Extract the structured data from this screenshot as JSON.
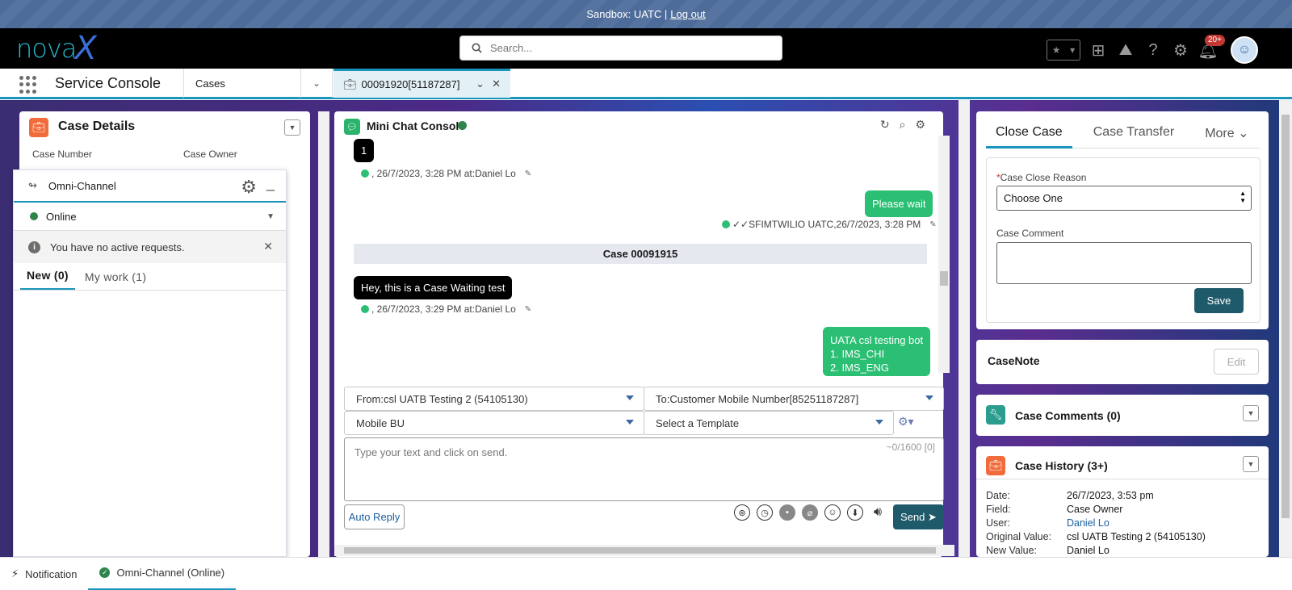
{
  "sandbox": {
    "text": "Sandbox: UATC |",
    "logout": "Log out"
  },
  "topbar": {
    "logo_text": "nova",
    "logo_x": "X",
    "search_placeholder": "Search...",
    "notif_badge": "20+"
  },
  "nav": {
    "app_name": "Service Console",
    "object": "Cases",
    "tab_label": "00091920[51187287]"
  },
  "case_details": {
    "title": "Case Details",
    "case_number_label": "Case Number",
    "case_owner_label": "Case Owner"
  },
  "omni": {
    "title": "Omni-Channel",
    "status": "Online",
    "info": "You have no active requests.",
    "tabs": [
      {
        "label": "New (0)"
      },
      {
        "label": "My work (1)"
      }
    ]
  },
  "chat": {
    "title": "Mini Chat Console",
    "messages": [
      {
        "text": "1",
        "meta": ", 26/7/2023, 3:28 PM at:Daniel Lo"
      },
      {
        "text": "Please wait",
        "meta": "✓✓SFIMTWILIO UATC,26/7/2023, 3:28 PM"
      },
      {
        "separator": "Case 00091915"
      },
      {
        "text": "Hey, this is a Case Waiting test",
        "meta": ", 26/7/2023, 3:29 PM at:Daniel Lo"
      },
      {
        "lines": [
          "UATA csl testing bot",
          "1. IMS_CHI",
          "2. IMS_ENG"
        ]
      }
    ],
    "from": "From:csl UATB Testing 2 (54105130)",
    "to": "To:Customer Mobile Number[85251187287]",
    "bu": "Mobile BU",
    "template": "Select a Template",
    "input_placeholder": "Type your text and click on send.",
    "counter": "~0/1600 [0]",
    "auto_reply": "Auto Reply",
    "send": "Send"
  },
  "close_case": {
    "tabs": [
      "Close Case",
      "Case Transfer",
      "More"
    ],
    "reason_label": "Case Close Reason",
    "reason_value": "Choose One",
    "comment_label": "Case Comment",
    "save": "Save"
  },
  "casenote": {
    "title": "CaseNote",
    "edit": "Edit"
  },
  "case_comments": {
    "title": "Case Comments (0)"
  },
  "case_history": {
    "title": "Case History (3+)",
    "rows": [
      {
        "k": "Date:",
        "v": "26/7/2023, 3:53 pm"
      },
      {
        "k": "Field:",
        "v": "Case Owner"
      },
      {
        "k": "User:",
        "v": "Daniel Lo"
      },
      {
        "k": "Original Value:",
        "v": "csl UATB Testing 2 (54105130)"
      },
      {
        "k": "New Value:",
        "v": "Daniel Lo"
      }
    ]
  },
  "statusbar": {
    "notification": "Notification",
    "omni": "Omni-Channel (Online)"
  }
}
